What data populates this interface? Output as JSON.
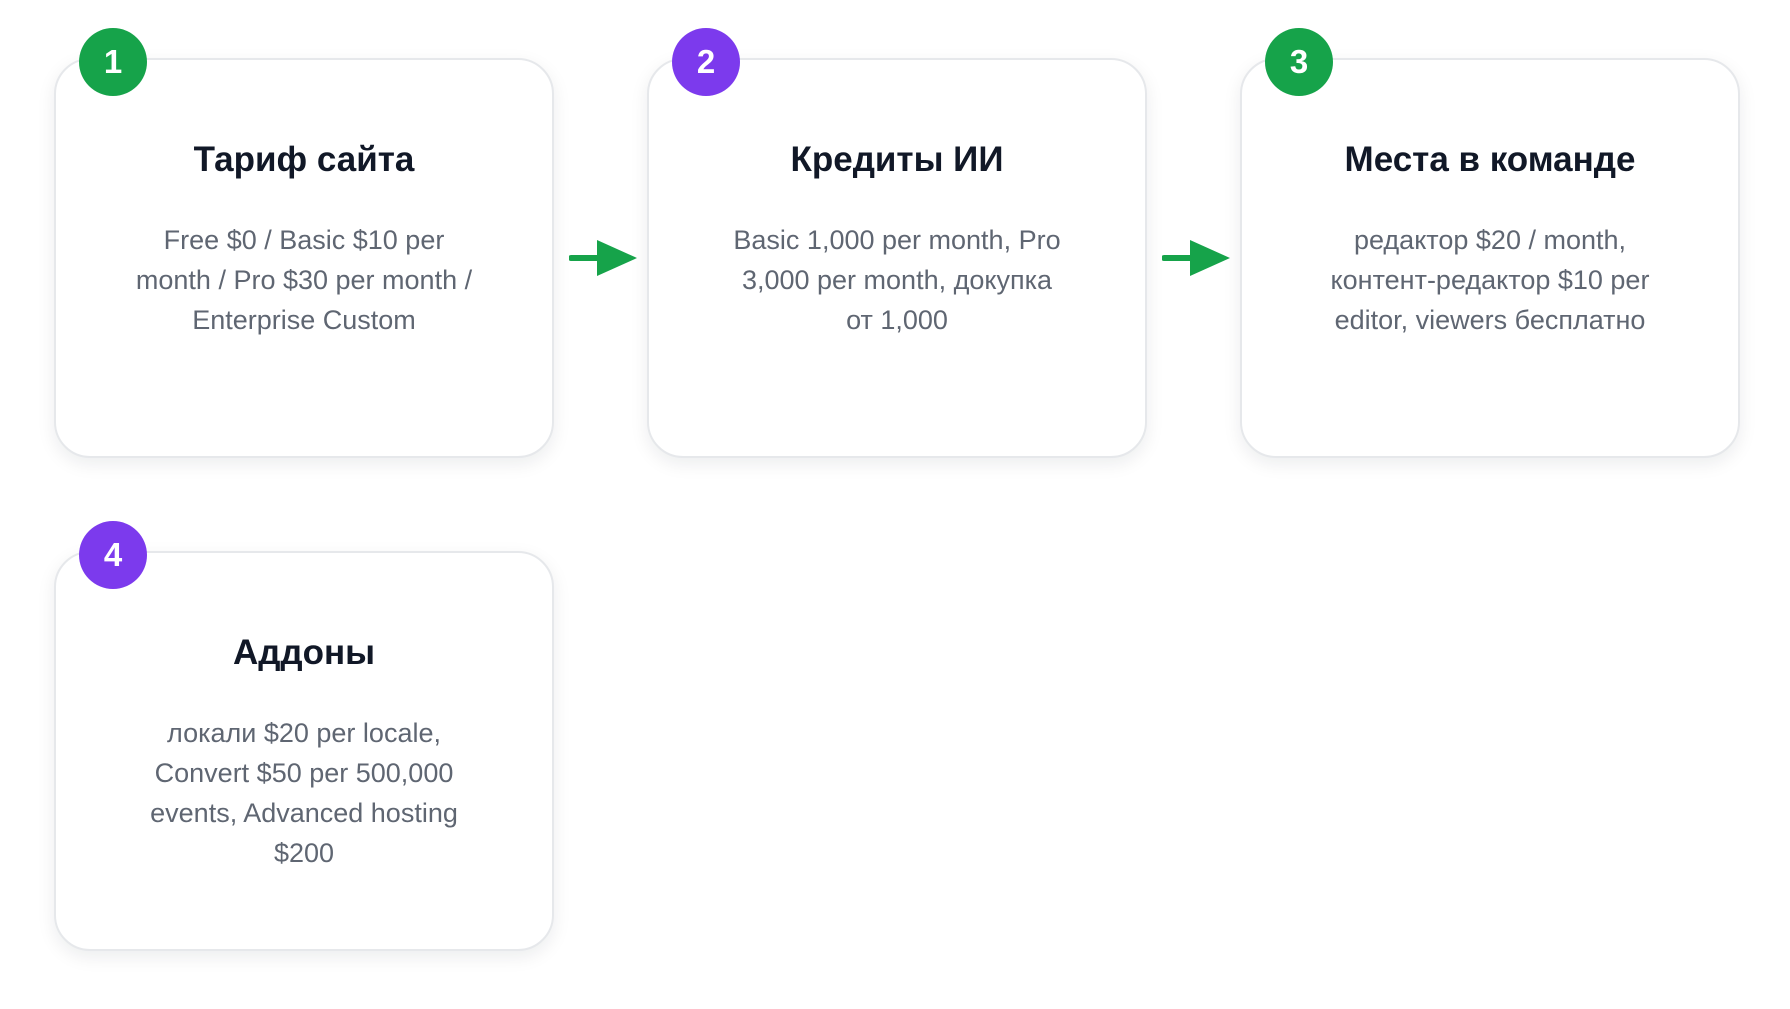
{
  "colors": {
    "green": "#16a34a",
    "purple": "#7c3aed",
    "arrow": "#16a34a",
    "title_text": "#111827",
    "body_text": "#5f6672",
    "card_border": "#e6e8eb"
  },
  "steps": [
    {
      "number": "1",
      "badge_color": "green",
      "title": "Тариф сайта",
      "description": "Free $0 / Basic $10 per month / Pro $30 per month / Enterprise Custom"
    },
    {
      "number": "2",
      "badge_color": "purple",
      "title": "Кредиты ИИ",
      "description": "Basic 1,000 per month, Pro 3,000 per month, докупка от 1,000"
    },
    {
      "number": "3",
      "badge_color": "green",
      "title": "Места в команде",
      "description": "редактор $20 / month, контент-редактор $10 per editor, viewers бесплатно"
    },
    {
      "number": "4",
      "badge_color": "purple",
      "title": "Аддоны",
      "description": "локали $20 per locale, Convert $50 per 500,000 events, Advanced hosting $200"
    }
  ],
  "connectors": [
    {
      "from": "1",
      "to": "2",
      "icon": "arrow-right-icon"
    },
    {
      "from": "2",
      "to": "3",
      "icon": "arrow-right-icon"
    }
  ]
}
